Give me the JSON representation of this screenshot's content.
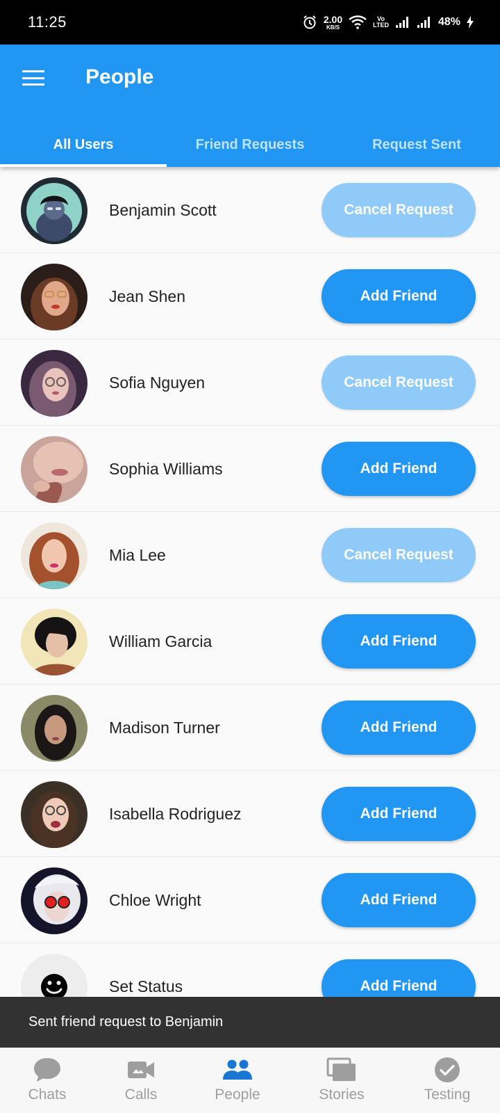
{
  "status_bar": {
    "time": "11:25",
    "net_speed_value": "2.00",
    "net_speed_unit": "KB/S",
    "volte_top": "Vo",
    "volte_bottom": "LTED",
    "battery": "48%",
    "icons": [
      "alarm-icon",
      "wifi-icon",
      "signal-icon",
      "battery-charging-icon"
    ]
  },
  "app_bar": {
    "title": "People",
    "menu_icon": "hamburger-menu-icon",
    "color": "#2196f3"
  },
  "tabs": [
    {
      "label": "All Users",
      "active": true
    },
    {
      "label": "Friend Requests",
      "active": false
    },
    {
      "label": "Request Sent",
      "active": false
    }
  ],
  "users": [
    {
      "name": "Benjamin Scott",
      "action": "Cancel Request"
    },
    {
      "name": "Jean Shen",
      "action": "Add Friend"
    },
    {
      "name": "Sofia Nguyen",
      "action": "Cancel Request"
    },
    {
      "name": "Sophia Williams",
      "action": "Add Friend"
    },
    {
      "name": "Mia Lee",
      "action": "Cancel Request"
    },
    {
      "name": "William Garcia",
      "action": "Add Friend"
    },
    {
      "name": "Madison Turner",
      "action": "Add Friend"
    },
    {
      "name": "Isabella Rodriguez",
      "action": "Add Friend"
    },
    {
      "name": "Chloe Wright",
      "action": "Add Friend"
    },
    {
      "name": "Set Status",
      "action": "Add Friend"
    }
  ],
  "snackbar": {
    "message": "Sent friend request to Benjamin"
  },
  "bottom_nav": [
    {
      "label": "Chats",
      "icon": "chat-bubble-icon",
      "active": false
    },
    {
      "label": "Calls",
      "icon": "video-camera-icon",
      "active": false
    },
    {
      "label": "People",
      "icon": "people-icon",
      "active": true
    },
    {
      "label": "Stories",
      "icon": "stacked-cards-icon",
      "active": false
    },
    {
      "label": "Testing",
      "icon": "check-circle-icon",
      "active": false
    }
  ],
  "colors": {
    "primary": "#2196f3",
    "primary_light": "#90caf9",
    "nav_active": "#1976d2",
    "nav_inactive": "#9e9e9e",
    "snackbar_bg": "#323232"
  }
}
